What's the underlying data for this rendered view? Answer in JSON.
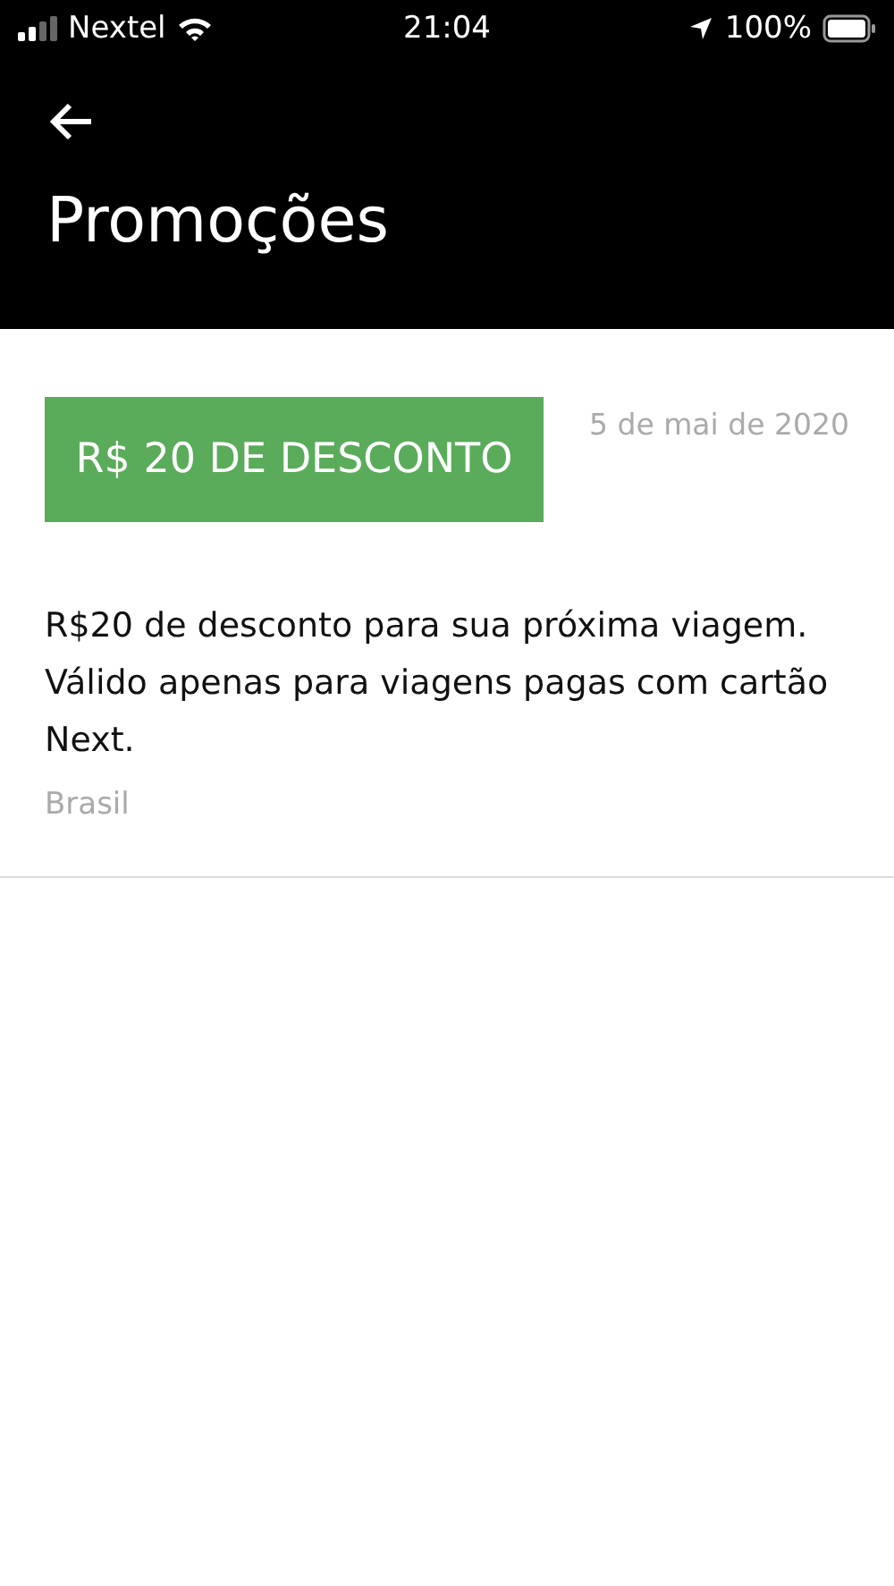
{
  "status_bar": {
    "carrier": "Nextel",
    "time": "21:04",
    "battery": "100%"
  },
  "header": {
    "title": "Promoções"
  },
  "promotions": [
    {
      "badge": "R$ 20 DE DESCONTO",
      "date": "5 de mai de 2020",
      "description": "R$20 de desconto para sua próxima viagem. Válido apenas para viagens pagas com cartão Next.",
      "region": "Brasil"
    }
  ]
}
